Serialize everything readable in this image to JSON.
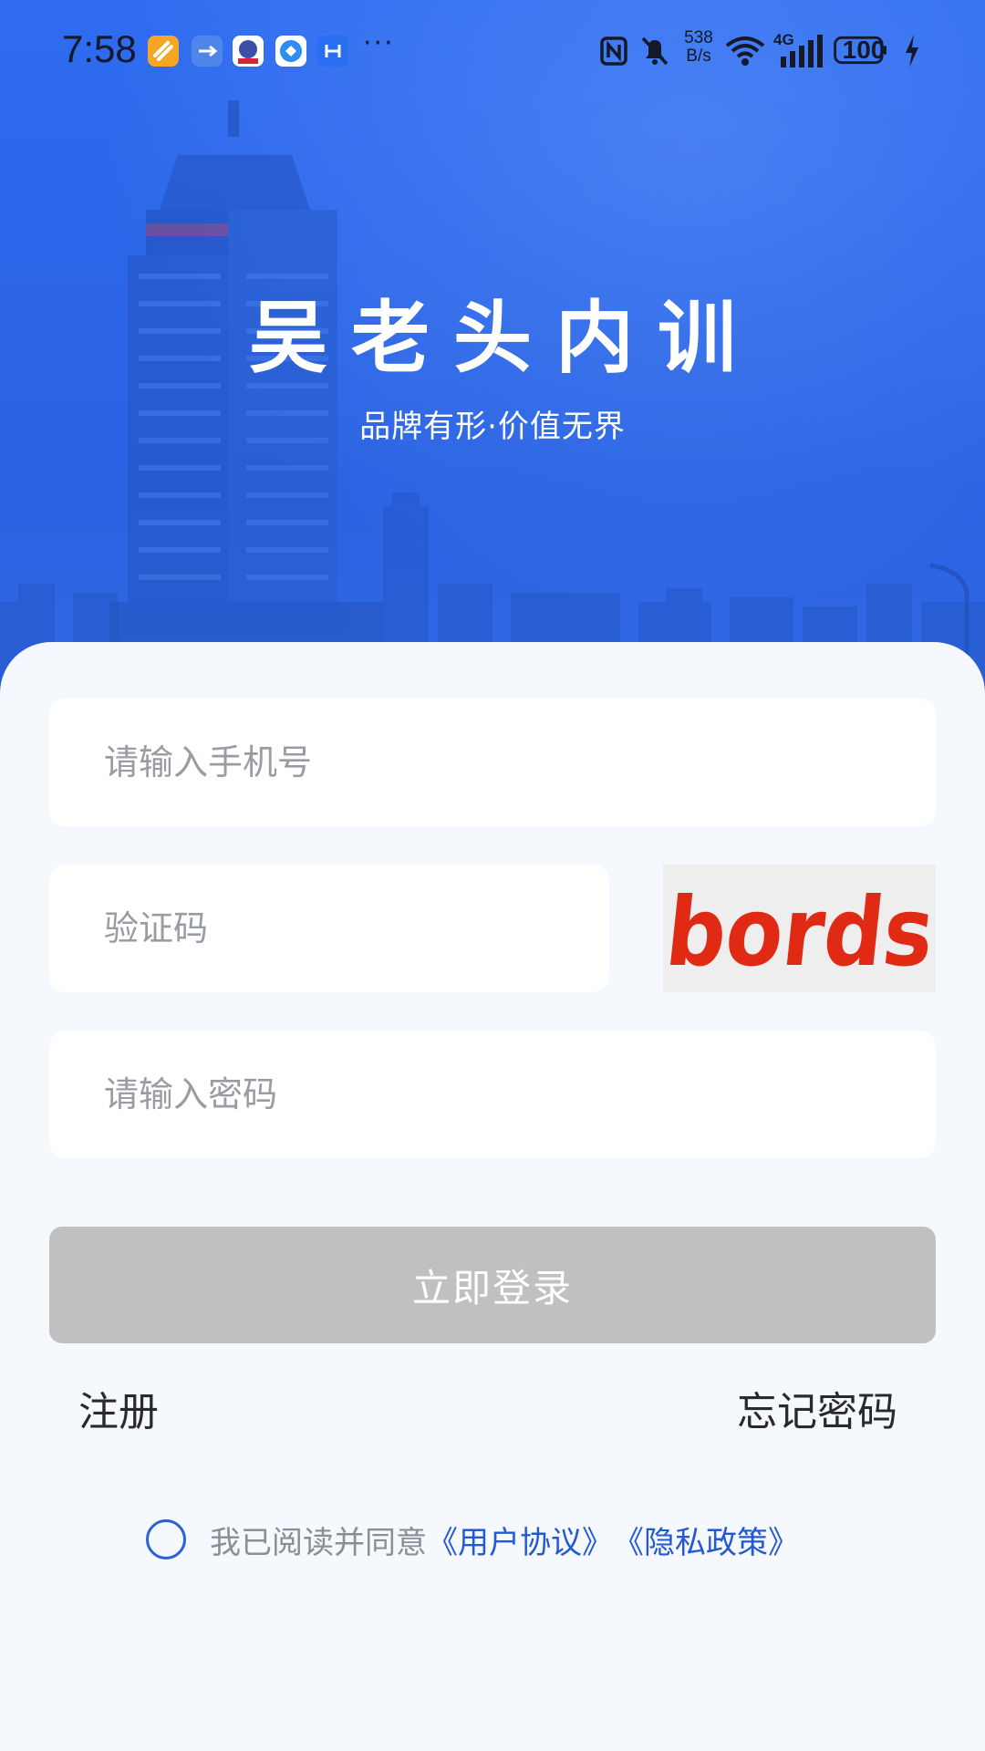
{
  "status_bar": {
    "time": "7:58",
    "net_speed_value": "538",
    "net_speed_unit": "B/s",
    "network_type": "4G",
    "battery": "100",
    "app_icons": [
      "app-orange-icon",
      "usb-icon",
      "app-badge-icon",
      "app-circle-icon",
      "app-blue-icon"
    ],
    "more": "···"
  },
  "hero": {
    "title": "吴老头内训",
    "slogan": "品牌有形·价值无界"
  },
  "form": {
    "phone_placeholder": "请输入手机号",
    "code_placeholder": "验证码",
    "captcha_text": "bords",
    "password_placeholder": "请输入密码",
    "login_label": "立即登录"
  },
  "links": {
    "register": "注册",
    "forgot_password": "忘记密码"
  },
  "agreement": {
    "prefix": "我已阅读并同意",
    "user_agreement": "《用户协议》",
    "privacy_policy": "《隐私政策》",
    "checked": false
  },
  "colors": {
    "brand_blue": "#2c66ea",
    "link_blue": "#2459d4",
    "button_disabled": "#c0c0c0",
    "captcha_red": "#e02a14"
  }
}
